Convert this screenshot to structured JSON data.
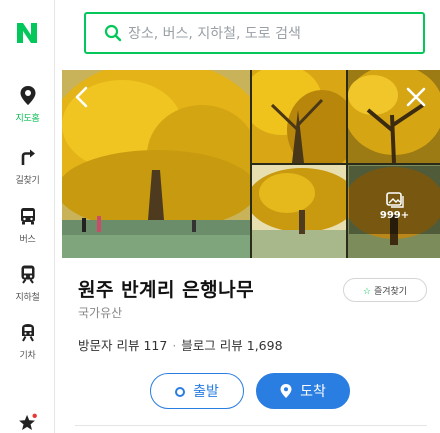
{
  "app": {
    "brand_letter": "N",
    "brand_color": "#03c75a",
    "accent_color": "#2a7de1"
  },
  "rail": {
    "items": [
      {
        "label": "지도홈",
        "icon": "map-pin-icon"
      },
      {
        "label": "길찾기",
        "icon": "directions-arrow-icon"
      },
      {
        "label": "버스",
        "icon": "bus-icon"
      },
      {
        "label": "지하철",
        "icon": "subway-icon"
      },
      {
        "label": "기차",
        "icon": "train-icon"
      },
      {
        "label": "",
        "icon": "favorites-star-icon"
      }
    ]
  },
  "search": {
    "placeholder": "장소, 버스, 지하철, 도로 검색",
    "value": ""
  },
  "gallery": {
    "more_count": "999+",
    "more_icon": "photo-stack-icon"
  },
  "place": {
    "name": "원주 반계리 은행나무",
    "category": "국가유산",
    "visitor_reviews": "방문자 리뷰 117",
    "blog_reviews": "블로그 리뷰 1,698",
    "save_label": "즐겨찾기"
  },
  "actions": {
    "origin_label": "출발",
    "destination_label": "도착"
  }
}
